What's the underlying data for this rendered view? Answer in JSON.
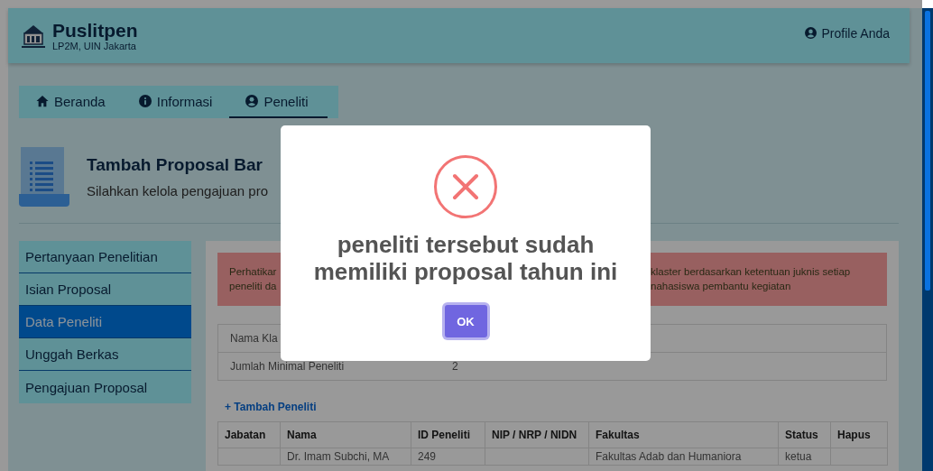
{
  "header": {
    "title": "Puslitpen",
    "subtitle": "LP2M, UIN Jakarta",
    "profile_link": "Profile Anda"
  },
  "nav_tabs": [
    {
      "label": "Beranda",
      "kind": "home",
      "selected": false
    },
    {
      "label": "Informasi",
      "kind": "info",
      "selected": false
    },
    {
      "label": "Peneliti",
      "kind": "user",
      "selected": true
    }
  ],
  "page_heading": {
    "title": "Tambah Proposal Bar",
    "subtitle": "Silahkan kelola pengajuan pro"
  },
  "sidebar": {
    "items": [
      {
        "label": "Pertanyaan Penelitian",
        "selected": false
      },
      {
        "label": "Isian Proposal",
        "selected": false
      },
      {
        "label": "Data Peneliti",
        "selected": true
      },
      {
        "label": "Unggah Berkas",
        "selected": false
      },
      {
        "label": "Pengajuan Proposal",
        "selected": false
      }
    ]
  },
  "alert": {
    "lines": [
      {
        "start": "Perhatikar",
        "end": "klaster berdasarkan ketentuan juknis setiap"
      },
      {
        "start": "peneliti da",
        "end": "nahasiswa pembantu kegiatan"
      }
    ]
  },
  "info_table": {
    "rows": [
      {
        "label": "Nama Kla"
      },
      {
        "label": "Jumlah Minimal Peneliti",
        "value": "2"
      }
    ]
  },
  "add_link": "+ Tambah Peneliti",
  "table": {
    "columns": [
      "Jabatan",
      "Nama",
      "ID Peneliti",
      "NIP / NRP / NIDN",
      "Fakultas",
      "Status",
      "Hapus"
    ],
    "rows": [
      {
        "nama": "Dr. Imam Subchi, MA",
        "id_peneliti": "249",
        "fakultas": "Fakultas Adab dan Humaniora",
        "status": "ketua"
      }
    ]
  },
  "dialog": {
    "message": "peneliti tersebut sudah memiliki proposal tahun ini",
    "button": "OK"
  }
}
